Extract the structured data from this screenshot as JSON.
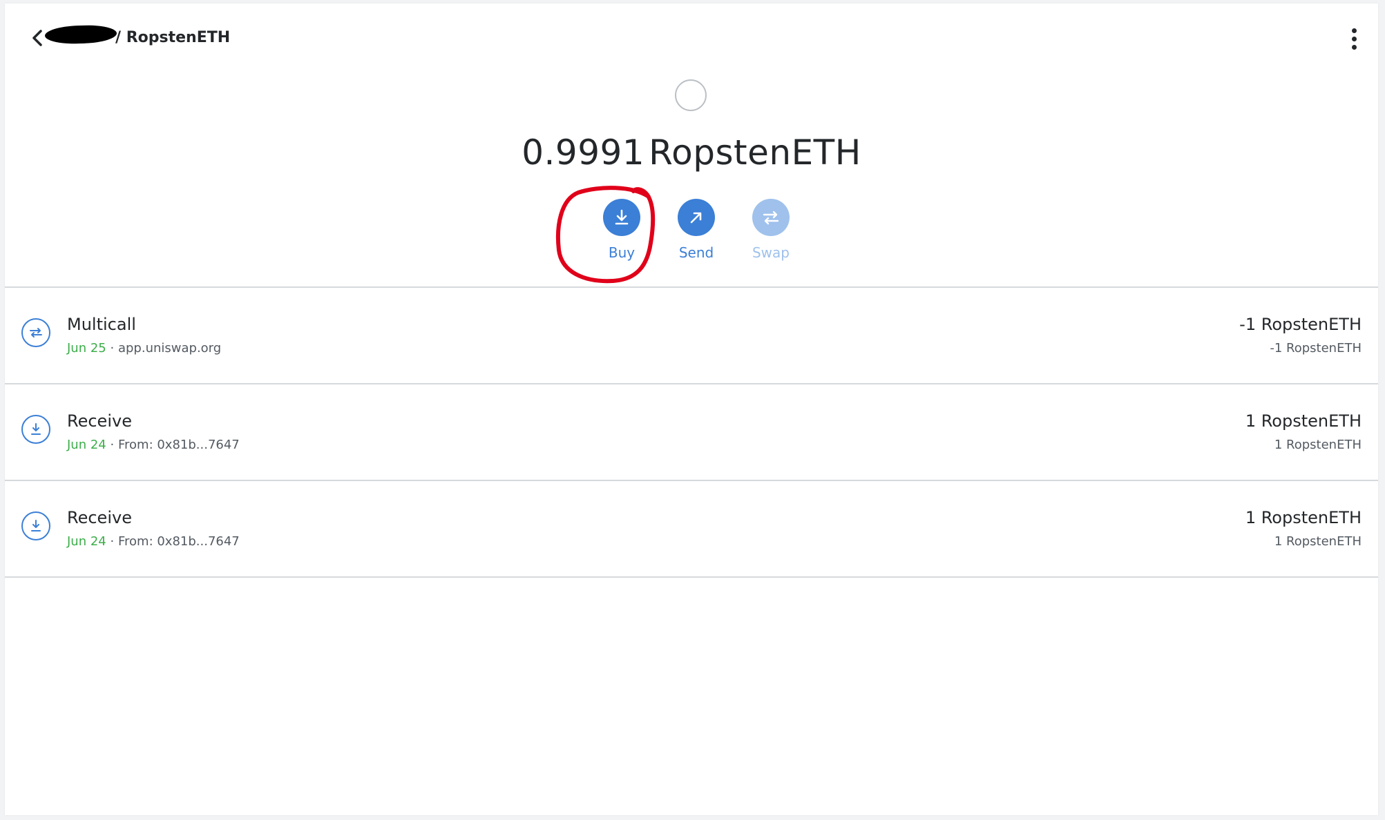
{
  "header": {
    "breadcrumb_token": "/ RopstenETH",
    "back_icon": "chevron-left-icon",
    "menu_icon": "kebab-menu-icon"
  },
  "overview": {
    "balance_amount": "0.9991",
    "balance_symbol": "RopstenETH",
    "actions": [
      {
        "label": "Buy",
        "icon": "download-arrow-icon",
        "enabled": true,
        "highlighted": true
      },
      {
        "label": "Send",
        "icon": "arrow-up-right-icon",
        "enabled": true
      },
      {
        "label": "Swap",
        "icon": "swap-arrows-icon",
        "enabled": false
      }
    ],
    "accent_color": "#3b7fd6",
    "highlight_color": "#e0001a"
  },
  "transactions": [
    {
      "icon": "swap-icon",
      "title": "Multicall",
      "date": "Jun 25",
      "detail": "app.uniswap.org",
      "primary": "-1 RopstenETH",
      "secondary": "-1 RopstenETH"
    },
    {
      "icon": "receive-icon",
      "title": "Receive",
      "date": "Jun 24",
      "detail": "From: 0x81b...7647",
      "primary": "1 RopstenETH",
      "secondary": "1 RopstenETH"
    },
    {
      "icon": "receive-icon",
      "title": "Receive",
      "date": "Jun 24",
      "detail": "From: 0x81b...7647",
      "primary": "1 RopstenETH",
      "secondary": "1 RopstenETH"
    }
  ],
  "dot_separator": "·"
}
